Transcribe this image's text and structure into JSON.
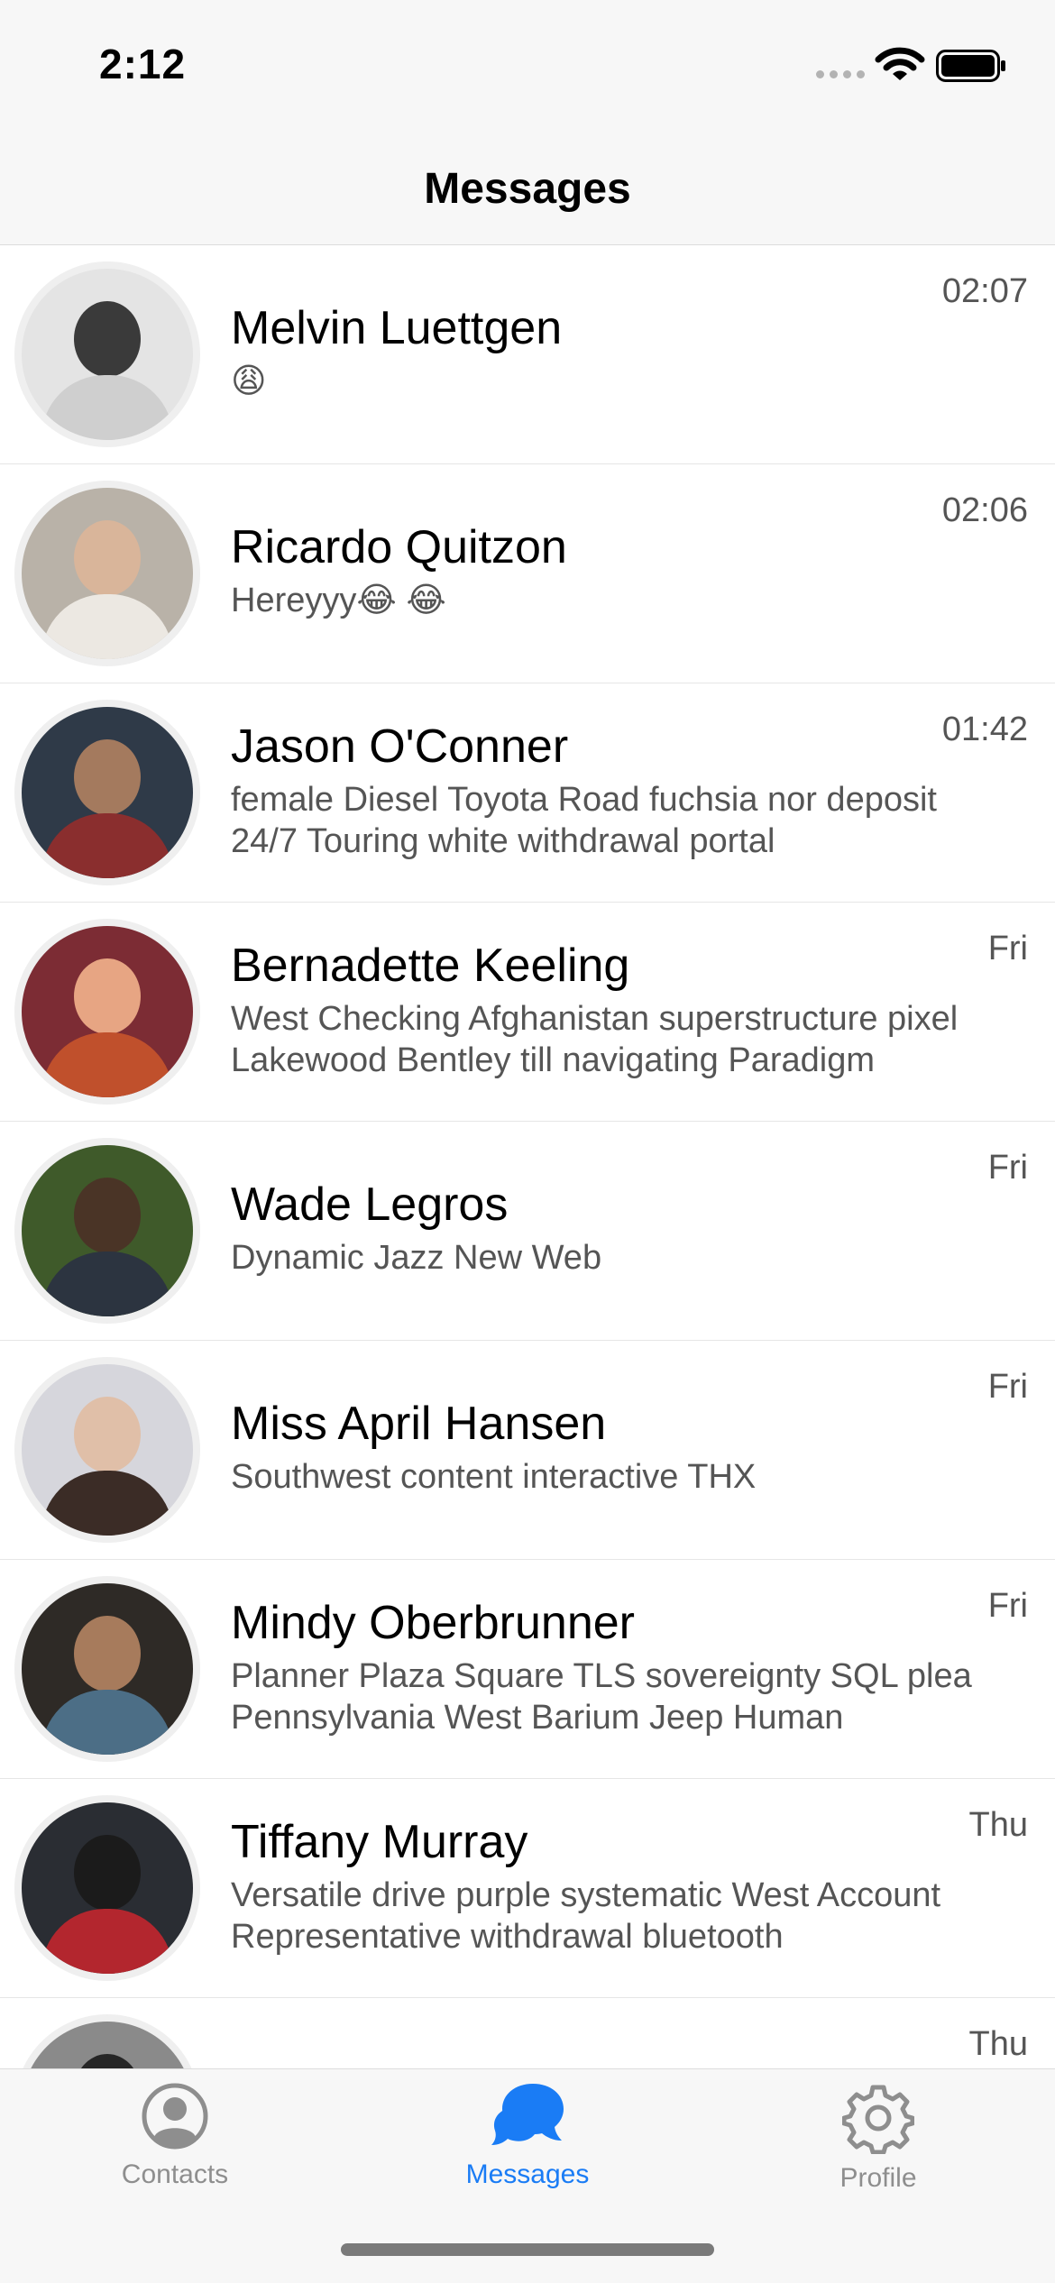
{
  "status_bar": {
    "time": "2:12"
  },
  "nav": {
    "title": "Messages"
  },
  "conversations": [
    {
      "name": "Melvin Luettgen",
      "preview": "😩",
      "time": "02:07"
    },
    {
      "name": "Ricardo Quitzon",
      "preview": "Hereyyy😂 😂",
      "time": "02:06"
    },
    {
      "name": "Jason O'Conner",
      "preview": "female Diesel Toyota Road fuchsia nor deposit 24/7 Touring white withdrawal portal",
      "time": "01:42"
    },
    {
      "name": "Bernadette Keeling",
      "preview": "West Checking Afghanistan superstructure pixel Lakewood Bentley till navigating Paradigm",
      "time": "Fri"
    },
    {
      "name": "Wade Legros",
      "preview": "Dynamic Jazz New Web",
      "time": "Fri"
    },
    {
      "name": "Miss April Hansen",
      "preview": "Southwest content interactive THX",
      "time": "Fri"
    },
    {
      "name": "Mindy Oberbrunner",
      "preview": "Planner Plaza Square TLS sovereignty SQL plea Pennsylvania West Barium Jeep Human",
      "time": "Fri"
    },
    {
      "name": "Tiffany Murray",
      "preview": "Versatile drive purple systematic West Account Representative withdrawal bluetooth",
      "time": "Thu"
    },
    {
      "name": "",
      "preview": "",
      "time": "Thu"
    }
  ],
  "tabs": [
    {
      "label": "Contacts",
      "icon": "person-circle-icon"
    },
    {
      "label": "Messages",
      "icon": "chat-bubbles-icon"
    },
    {
      "label": "Profile",
      "icon": "gear-icon"
    }
  ],
  "colors": {
    "accent": "#1a7cf5",
    "inactive": "#8e8e8e",
    "bar_background": "#f7f7f7"
  }
}
